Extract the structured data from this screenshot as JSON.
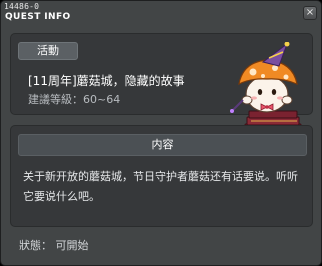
{
  "header": {
    "quest_id": "14486-0",
    "title": "QUEST INFO",
    "close_symbol": "×"
  },
  "quest": {
    "tag": "活動",
    "name": "[11周年]蘑菇城，隐藏的故事",
    "level": "建議等級：60~64"
  },
  "content": {
    "header": "内容",
    "description": "关于新开放的蘑菇城，节日守护者蘑菇还有话要说。听听它要说什么吧。"
  },
  "status": "狀態： 可開始",
  "icons": {
    "mascot": "mushroom-mascot-icon",
    "close": "close-icon"
  },
  "colors": {
    "window_bg": "#424546",
    "panel_bg": "#36383a",
    "tag_bg": "#5b6064",
    "mushroom_cap": "#f08a24",
    "hat_purple": "#7a4fa0"
  }
}
